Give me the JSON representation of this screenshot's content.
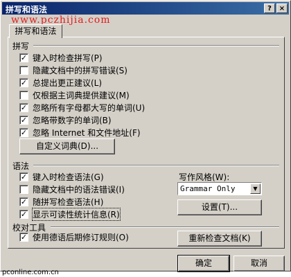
{
  "window": {
    "title": "拼写和语法",
    "help_glyph": "?",
    "close_glyph": "×"
  },
  "watermark": "www.pczhijia.com",
  "tab": {
    "label": "拼写和语法"
  },
  "spelling": {
    "heading": "拼写",
    "options": [
      {
        "label": "键入时检查拼写(P)",
        "checked": true
      },
      {
        "label": "隐藏文档中的拼写错误(S)",
        "checked": false
      },
      {
        "label": "总提出更正建议(L)",
        "checked": true
      },
      {
        "label": "仅根据主词典提供建议(M)",
        "checked": false
      },
      {
        "label": "忽略所有字母都大写的单词(U)",
        "checked": true
      },
      {
        "label": "忽略带数字的单词(B)",
        "checked": true
      },
      {
        "label": "忽略 Internet 和文件地址(F)",
        "checked": true
      }
    ],
    "dictionary_button": "自定义词典(D)..."
  },
  "grammar": {
    "heading": "语法",
    "options": [
      {
        "label": "键入时检查语法(G)",
        "checked": true
      },
      {
        "label": "隐藏文档中的语法错误(I)",
        "checked": false
      },
      {
        "label": "随拼写检查语法(H)",
        "checked": true
      },
      {
        "label": "显示可读性统计信息(R)",
        "checked": true
      }
    ],
    "style_label": "写作风格(W):",
    "style_value": "Grammar Only",
    "settings_button": "设置(T)..."
  },
  "proofing": {
    "heading": "校对工具",
    "options": [
      {
        "label": "使用德语后期修订规则(O)",
        "checked": true
      }
    ],
    "recheck_button": "重新检查文档(K)"
  },
  "buttons": {
    "ok": "确定",
    "cancel": "取消"
  },
  "footer": "pconline.com.cn"
}
